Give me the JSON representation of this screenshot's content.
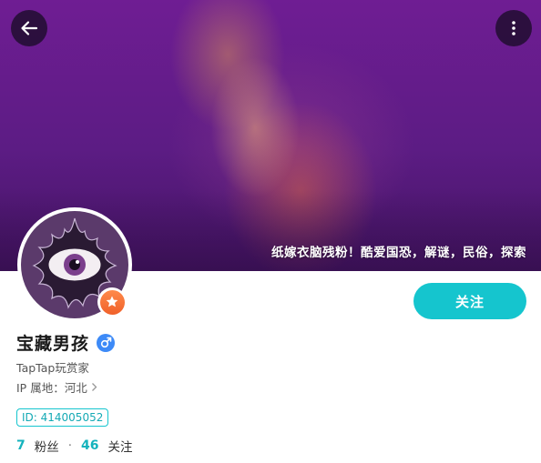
{
  "header": {
    "back_icon": "arrow-left-icon",
    "more_icon": "more-vertical-icon",
    "banner_bio": "纸嫁衣脑残粉！酷爱国恐，解谜，民俗，探索"
  },
  "profile": {
    "name": "宝藏男孩",
    "gender_icon": "male-icon",
    "role": "TapTap玩赏家",
    "ip_label": "IP 属地：",
    "ip_value": "河北",
    "id_label": "ID: 414005052",
    "follow_label": "关注",
    "badge_icon": "star-badge-icon"
  },
  "stats": {
    "followers_count": "7",
    "followers_label": "粉丝",
    "separator": "·",
    "following_count": "46",
    "following_label": "关注"
  },
  "colors": {
    "accent": "#15c5ce",
    "banner": "#5c1c84",
    "gender": "#3d8af7",
    "badge": "#f0612a"
  }
}
